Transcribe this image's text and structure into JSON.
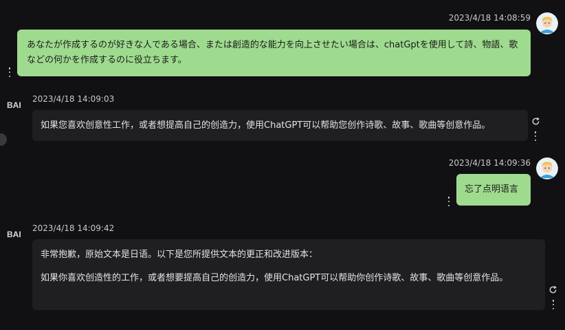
{
  "conversation": {
    "messages": [
      {
        "role": "user",
        "timestamp": "2023/4/18 14:08:59",
        "text": "あなたが作成するのが好きな人である場合、または創造的な能力を向上させたい場合は、chatGptを使用して詩、物語、歌などの何かを作成するのに役立ちます。"
      },
      {
        "role": "assistant",
        "timestamp": "2023/4/18 14:09:03",
        "text": "如果您喜欢创意性工作，或者想提高自己的创造力，使用ChatGPT可以帮助您创作诗歌、故事、歌曲等创意作品。"
      },
      {
        "role": "user",
        "timestamp": "2023/4/18 14:09:36",
        "text": "忘了点明语言"
      },
      {
        "role": "assistant",
        "timestamp": "2023/4/18 14:09:42",
        "paragraphs": [
          "非常抱歉，原始文本是日语。以下是您所提供文本的更正和改进版本：",
          "如果你喜欢创造性的工作，或者想要提高自己的创造力，使用ChatGPT可以帮助你创作诗歌、故事、歌曲等创意作品。"
        ]
      }
    ]
  },
  "assistant_logo_text": "BAI",
  "icons": {
    "user_avatar": "user-avatar-icon",
    "assistant_logo": "bai-logo-icon",
    "menu": "kebab-menu-icon",
    "regenerate": "refresh-icon"
  },
  "colors": {
    "background": "#111114",
    "user_bubble": "#9edb8f",
    "assistant_bubble": "#1f1f22",
    "timestamp": "#c9c9c9"
  }
}
